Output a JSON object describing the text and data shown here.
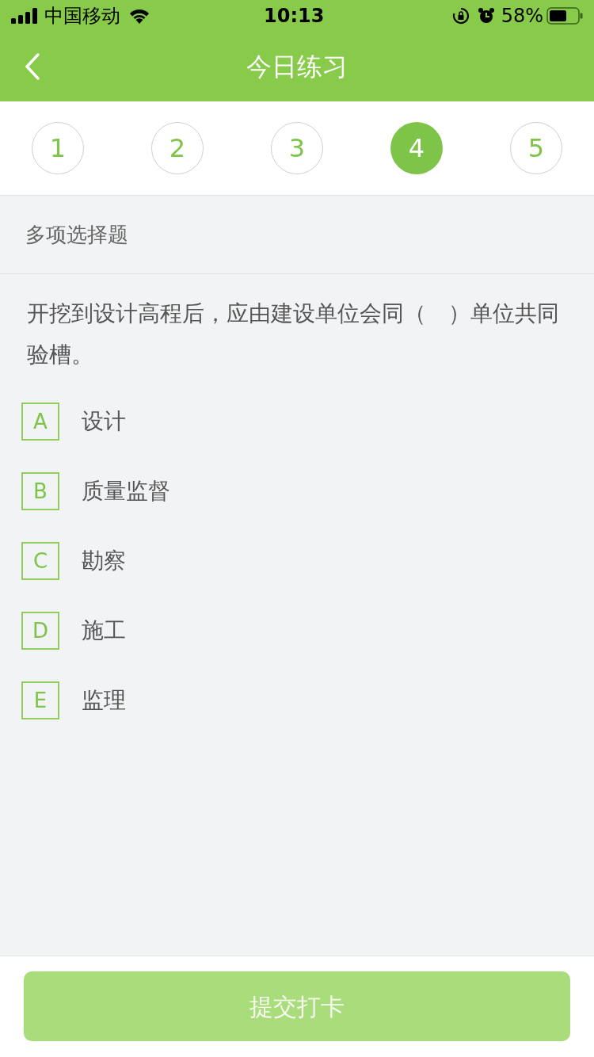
{
  "status_bar": {
    "carrier": "中国移动",
    "time": "10:13",
    "battery_percent": "58%"
  },
  "nav": {
    "title": "今日练习"
  },
  "steps": [
    {
      "label": "1",
      "selected": false
    },
    {
      "label": "2",
      "selected": false
    },
    {
      "label": "3",
      "selected": false
    },
    {
      "label": "4",
      "selected": true
    },
    {
      "label": "5",
      "selected": false
    }
  ],
  "question": {
    "type_label": "多项选择题",
    "text": "开挖到设计高程后，应由建设单位会同（　）单位共同验槽。",
    "options": [
      {
        "letter": "A",
        "text": "设计",
        "selected": false
      },
      {
        "letter": "B",
        "text": "质量监督",
        "selected": false
      },
      {
        "letter": "C",
        "text": "勘察",
        "selected": false
      },
      {
        "letter": "D",
        "text": "施工",
        "selected": false
      },
      {
        "letter": "E",
        "text": "监理",
        "selected": false
      }
    ]
  },
  "submit": {
    "label": "提交打卡",
    "disabled": true
  }
}
